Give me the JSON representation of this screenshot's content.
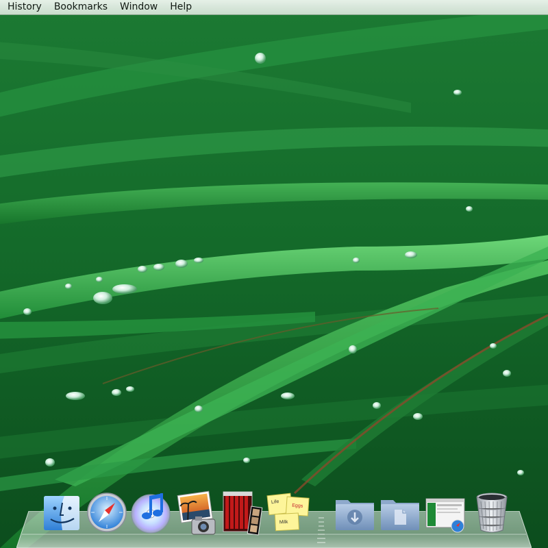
{
  "menubar": {
    "items": [
      {
        "label": "History"
      },
      {
        "label": "Bookmarks"
      },
      {
        "label": "Window"
      },
      {
        "label": "Help"
      }
    ]
  },
  "wallpaper": {
    "subject": "green grass blades with dew drops",
    "colors": {
      "dark": "#0b4a1b",
      "mid": "#1f7f36",
      "light": "#5fcf6a"
    }
  },
  "dock": {
    "apps": [
      {
        "name": "Finder",
        "icon": "finder-icon"
      },
      {
        "name": "Safari",
        "icon": "safari-icon"
      },
      {
        "name": "iTunes",
        "icon": "itunes-icon"
      },
      {
        "name": "iPhoto",
        "icon": "iphoto-icon"
      },
      {
        "name": "Photo Booth",
        "icon": "photo-booth-icon"
      },
      {
        "name": "Stickies",
        "icon": "stickies-icon"
      }
    ],
    "stickies_notes": [
      "Life",
      "Eggs",
      "Milk"
    ],
    "stacks": [
      {
        "name": "Downloads",
        "icon": "downloads-folder-icon"
      },
      {
        "name": "Documents",
        "icon": "documents-folder-icon"
      },
      {
        "name": "Minimized window",
        "icon": "minimized-window-icon"
      },
      {
        "name": "Trash",
        "icon": "trash-icon"
      }
    ]
  }
}
